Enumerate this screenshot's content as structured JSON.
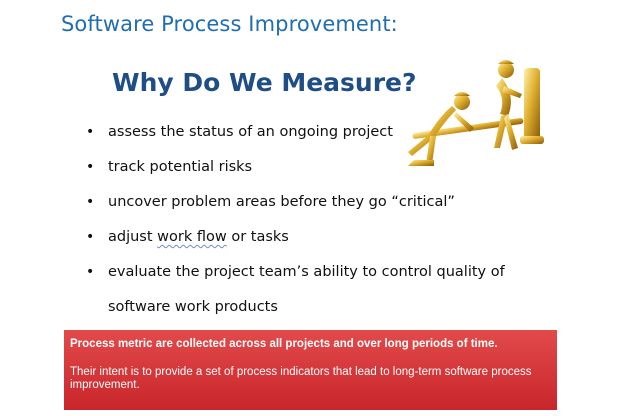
{
  "header": {
    "title": "Software Process Improvement:"
  },
  "slide": {
    "title": "Why Do We Measure?",
    "bullets": [
      {
        "bullet": "•",
        "text": "assess the status of an ongoing project"
      },
      {
        "bullet": "•",
        "text": "track potential risks"
      },
      {
        "bullet": "•",
        "text": "uncover problem areas before they go “critical”"
      },
      {
        "bullet": "•",
        "text_before": "adjust ",
        "text_underlined": "work flow",
        "text_after": " or tasks"
      },
      {
        "bullet": "•",
        "text": "evaluate the project team’s ability to control quality of",
        "text_line2": "software work products"
      }
    ]
  },
  "callout": {
    "line1": "Process metric are collected across all projects and over long periods of time.",
    "line2": "Their intent is to provide a set of process indicators that lead to long-term software process improvement.",
    "background": "#d63a3d"
  },
  "figure": {
    "icon": "golden-figures-lever-icon",
    "color": "#e0b030"
  }
}
